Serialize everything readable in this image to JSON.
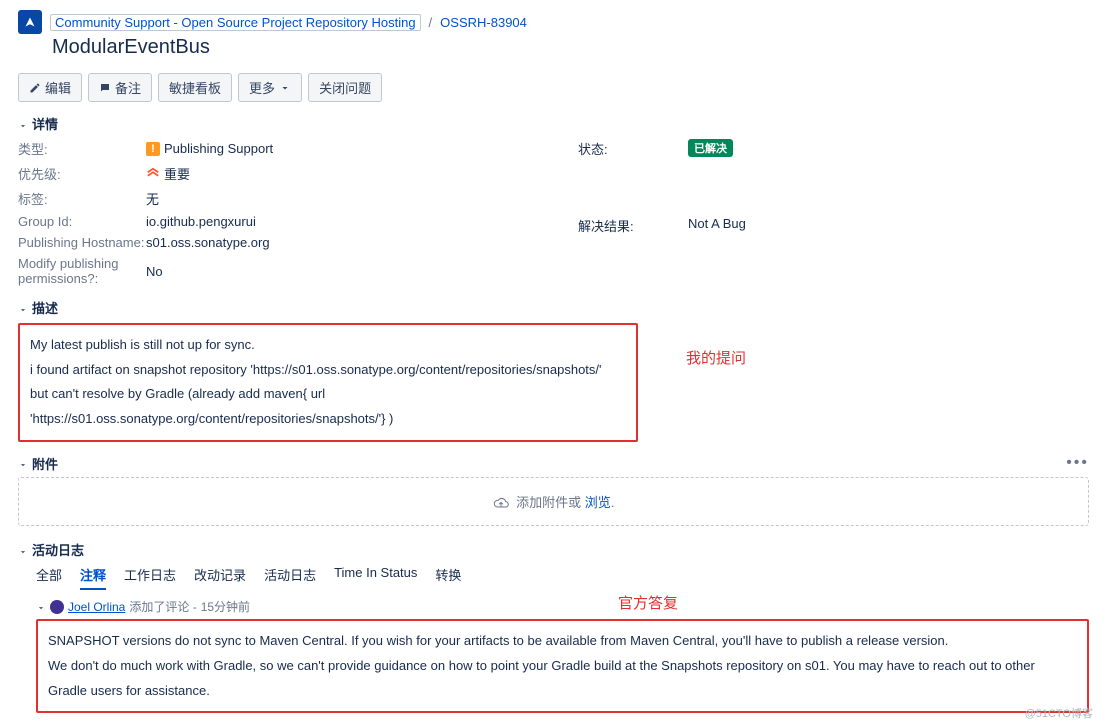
{
  "breadcrumbs": {
    "project": "Community Support - Open Source Project Repository Hosting",
    "issue": "OSSRH-83904"
  },
  "title": "ModularEventBus",
  "toolbar": {
    "edit": "编辑",
    "remark": "备注",
    "agile": "敏捷看板",
    "more": "更多",
    "close": "关闭问题"
  },
  "sections": {
    "details": "详情",
    "description": "描述",
    "attachments": "附件",
    "activity": "活动日志"
  },
  "details": {
    "left": {
      "type_label": "类型:",
      "type_value": "Publishing Support",
      "priority_label": "优先级:",
      "priority_value": "重要",
      "labels_label": "标签:",
      "labels_value": "无",
      "group_label": "Group Id:",
      "group_value": "io.github.pengxurui",
      "host_label": "Publishing Hostname:",
      "host_value": "s01.oss.sonatype.org",
      "perm_label": "Modify publishing permissions?:",
      "perm_value": "No"
    },
    "right": {
      "status_label": "状态:",
      "status_value": "已解决",
      "resolution_label": "解决结果:",
      "resolution_value": "Not A Bug"
    }
  },
  "description": {
    "line1": "My latest publish is still not up for sync.",
    "line2": "i found artifact on snapshot repository 'https://s01.oss.sonatype.org/content/repositories/snapshots/'",
    "line3": "but can't resolve by Gradle (already add maven{ url 'https://s01.oss.sonatype.org/content/repositories/snapshots/'} )"
  },
  "annotations": {
    "question": "我的提问",
    "answer": "官方答复"
  },
  "attachments": {
    "drop_text": "添加附件或 ",
    "browse": "浏览"
  },
  "tabs": {
    "all": "全部",
    "comments": "注释",
    "worklog": "工作日志",
    "history": "改动记录",
    "activity": "活动日志",
    "time": "Time In Status",
    "transitions": "转换"
  },
  "comment": {
    "author": "Joel Orlina",
    "action": "添加了评论 -",
    "time": "15分钟前",
    "body1": "SNAPSHOT versions do not sync to Maven Central. If you wish for your artifacts to be available from Maven Central, you'll have to publish a release version.",
    "body2": "We don't do much work with Gradle, so we can't provide guidance on how to point your Gradle build at the Snapshots repository on s01. You may have to reach out to other Gradle users for assistance."
  },
  "watermark": "@51CTO博客"
}
